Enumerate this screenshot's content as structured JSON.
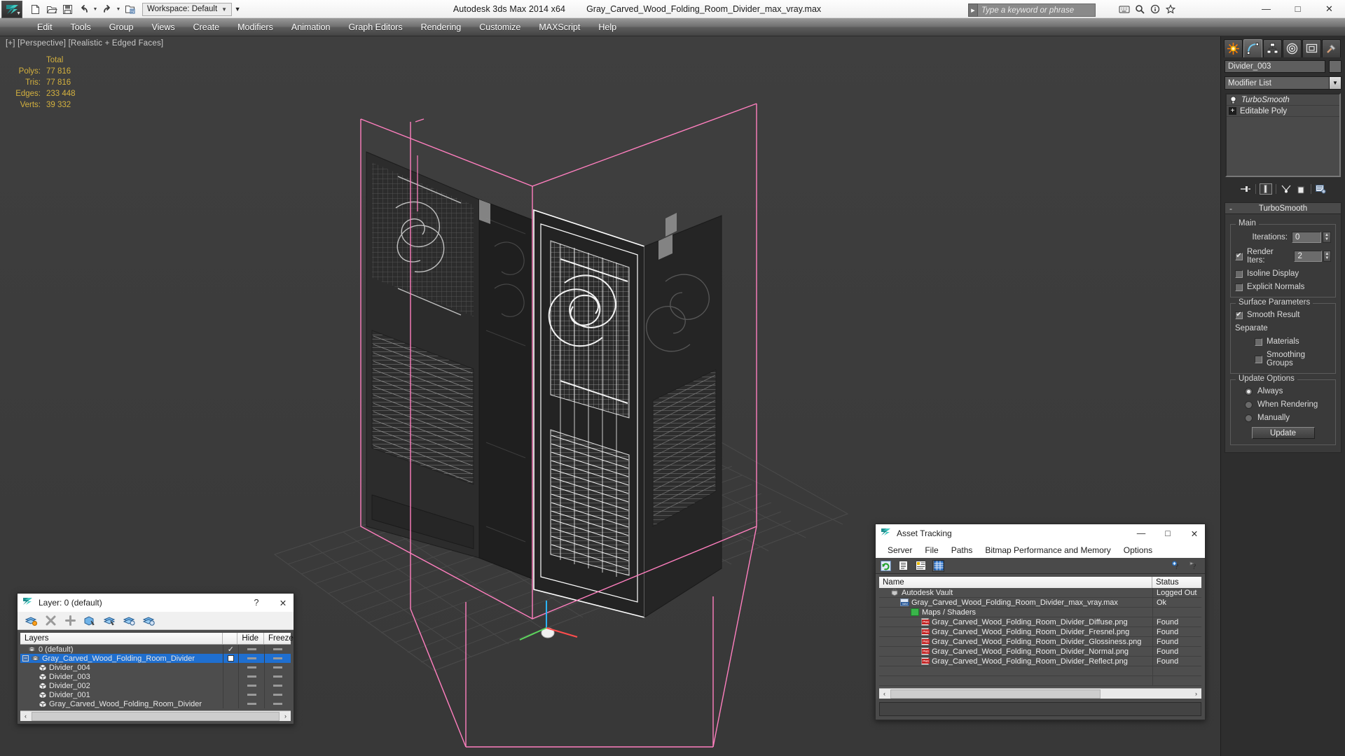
{
  "app": {
    "product_title": "Autodesk 3ds Max  2014 x64",
    "file_title": "Gray_Carved_Wood_Folding_Room_Divider_max_vray.max",
    "logo_icon": "3dsmax-logo-icon"
  },
  "window_controls": {
    "minimize": "—",
    "maximize": "□",
    "close": "✕"
  },
  "quick_access": {
    "items": [
      {
        "name": "new-file-icon",
        "glyph": "new"
      },
      {
        "name": "open-file-icon",
        "glyph": "open"
      },
      {
        "name": "save-file-icon",
        "glyph": "save"
      },
      {
        "name": "undo-icon",
        "glyph": "undo"
      },
      {
        "name": "redo-icon",
        "glyph": "redo"
      },
      {
        "name": "set-project-folder-icon",
        "glyph": "project"
      }
    ],
    "workspace_label": "Workspace: Default",
    "workspace_dropdown_icon": "chevron-down-icon"
  },
  "menu": {
    "items": [
      "Edit",
      "Tools",
      "Group",
      "Views",
      "Create",
      "Modifiers",
      "Animation",
      "Graph Editors",
      "Rendering",
      "Customize",
      "MAXScript",
      "Help"
    ]
  },
  "search": {
    "placeholder": "Type a keyword or phrase",
    "value": "",
    "arrow_icon": "triangle-right-icon",
    "trailing_icons": [
      "keyboard-shortcut-icon",
      "search-icon",
      "info-icon",
      "favorites-star-icon"
    ]
  },
  "viewport": {
    "label": "[+] [Perspective] [Realistic + Edged Faces]",
    "stats": {
      "header": "Total",
      "rows": [
        {
          "label": "Polys:",
          "value": "77 816"
        },
        {
          "label": "Tris:",
          "value": "77 816"
        },
        {
          "label": "Edges:",
          "value": "233 448"
        },
        {
          "label": "Verts:",
          "value": "39 332"
        }
      ]
    },
    "stats_color": "#d4b13e",
    "background_color": "#3c3c3c",
    "selection_bracket_color": "#ff7fbf"
  },
  "command_panel": {
    "tabs": [
      {
        "name": "create-tab",
        "icon": "star-burst-icon",
        "active": false
      },
      {
        "name": "modify-tab",
        "icon": "curve-arc-icon",
        "active": true
      },
      {
        "name": "hierarchy-tab",
        "icon": "hierarchy-icon",
        "active": false
      },
      {
        "name": "motion-tab",
        "icon": "motion-wheel-icon",
        "active": false
      },
      {
        "name": "display-tab",
        "icon": "display-monitor-icon",
        "active": false
      },
      {
        "name": "utilities-tab",
        "icon": "hammer-icon",
        "active": false
      }
    ],
    "object_name": "Divider_003",
    "modifier_list_label": "Modifier List",
    "modifier_stack": [
      {
        "label": "TurboSmooth",
        "icon": "lightbulb-icon",
        "italic": true
      },
      {
        "label": "Editable Poly",
        "icon": "plus-box-icon",
        "italic": false
      }
    ],
    "stack_buttons": [
      {
        "name": "pin-stack-button",
        "icon": "pin-icon"
      },
      {
        "name": "show-end-result-button",
        "icon": "show-end-result-icon"
      },
      {
        "name": "make-unique-button",
        "icon": "make-unique-icon"
      },
      {
        "name": "remove-modifier-button",
        "icon": "trash-icon"
      },
      {
        "name": "configure-modifier-sets-button",
        "icon": "configure-sets-icon"
      }
    ],
    "rollout": {
      "title": "TurboSmooth",
      "collapse_glyph": "-",
      "main_group": {
        "title": "Main",
        "iterations_label": "Iterations:",
        "iterations_value": "0",
        "render_iters_label": "Render Iters:",
        "render_iters_value": "2",
        "render_iters_checked": true,
        "isoline_display_label": "Isoline Display",
        "isoline_display_checked": false,
        "explicit_normals_label": "Explicit Normals",
        "explicit_normals_checked": false
      },
      "surface_group": {
        "title": "Surface Parameters",
        "smooth_result_label": "Smooth Result",
        "smooth_result_checked": true,
        "separate_label": "Separate",
        "materials_label": "Materials",
        "materials_checked": false,
        "smoothing_groups_label": "Smoothing Groups",
        "smoothing_groups_checked": false
      },
      "update_group": {
        "title": "Update Options",
        "options": [
          {
            "label": "Always",
            "selected": true
          },
          {
            "label": "When Rendering",
            "selected": false
          },
          {
            "label": "Manually",
            "selected": false
          }
        ],
        "update_button": "Update"
      }
    }
  },
  "layer_dialog": {
    "title": "Layer: 0 (default)",
    "help_glyph": "?",
    "close_glyph": "✕",
    "toolbar_icons": [
      {
        "name": "create-new-layer-icon"
      },
      {
        "name": "delete-highlighted-layer-icon"
      },
      {
        "name": "add-selection-to-layer-icon"
      },
      {
        "name": "select-objects-in-layer-icon"
      },
      {
        "name": "highlight-selected-objects-layer-icon"
      },
      {
        "name": "set-current-layer-to-selection-icon"
      },
      {
        "name": "layer-properties-icon"
      }
    ],
    "columns": [
      "Layers",
      "",
      "Hide",
      "Freeze"
    ],
    "rows": [
      {
        "name": "0 (default)",
        "indent": 0,
        "icon": "layers-icon",
        "current": true,
        "selected": false,
        "hide": "-",
        "freeze": "-"
      },
      {
        "name": "Gray_Carved_Wood_Folding_Room_Divider",
        "indent": 1,
        "icon": "layers-icon",
        "expander": "-",
        "current": false,
        "selected": true,
        "hide": "-",
        "freeze": "-"
      },
      {
        "name": "Divider_004",
        "indent": 2,
        "icon": "cube-icon",
        "current": false,
        "selected": false,
        "hide": "-",
        "freeze": "-"
      },
      {
        "name": "Divider_003",
        "indent": 2,
        "icon": "cube-icon",
        "current": false,
        "selected": false,
        "hide": "-",
        "freeze": "-"
      },
      {
        "name": "Divider_002",
        "indent": 2,
        "icon": "cube-icon",
        "current": false,
        "selected": false,
        "hide": "-",
        "freeze": "-"
      },
      {
        "name": "Divider_001",
        "indent": 2,
        "icon": "cube-icon",
        "current": false,
        "selected": false,
        "hide": "-",
        "freeze": "-"
      },
      {
        "name": "Gray_Carved_Wood_Folding_Room_Divider",
        "indent": 2,
        "icon": "cube-icon",
        "current": false,
        "selected": false,
        "hide": "-",
        "freeze": "-"
      }
    ],
    "scroll_left_glyph": "‹",
    "scroll_right_glyph": "›"
  },
  "asset_tracking": {
    "title": "Asset Tracking",
    "title_icon": "3dsmax-logo-icon",
    "minimize_glyph": "—",
    "maximize_glyph": "□",
    "close_glyph": "✕",
    "menu": [
      "Server",
      "File",
      "Paths",
      "Bitmap Performance and Memory",
      "Options"
    ],
    "toolbar_icons": [
      {
        "name": "refresh-icon",
        "selected": false
      },
      {
        "name": "list-view-icon",
        "selected": false
      },
      {
        "name": "details-view-icon",
        "selected": false
      },
      {
        "name": "grid-view-icon",
        "selected": true
      }
    ],
    "help_icons": [
      {
        "name": "help-add-icon"
      },
      {
        "name": "help-question-icon"
      }
    ],
    "columns": [
      "Name",
      "Status"
    ],
    "rows": [
      {
        "name": "Autodesk Vault",
        "status": "Logged Out",
        "indent": 0,
        "icon": "vault-icon"
      },
      {
        "name": "Gray_Carved_Wood_Folding_Room_Divider_max_vray.max",
        "status": "Ok",
        "indent": 1,
        "icon": "max-file-icon"
      },
      {
        "name": "Maps / Shaders",
        "status": "",
        "indent": 2,
        "icon": "maps-shaders-icon"
      },
      {
        "name": "Gray_Carved_Wood_Folding_Room_Divider_Diffuse.png",
        "status": "Found",
        "indent": 3,
        "icon": "png-file-icon"
      },
      {
        "name": "Gray_Carved_Wood_Folding_Room_Divider_Fresnel.png",
        "status": "Found",
        "indent": 3,
        "icon": "png-file-icon"
      },
      {
        "name": "Gray_Carved_Wood_Folding_Room_Divider_Glossiness.png",
        "status": "Found",
        "indent": 3,
        "icon": "png-file-icon"
      },
      {
        "name": "Gray_Carved_Wood_Folding_Room_Divider_Normal.png",
        "status": "Found",
        "indent": 3,
        "icon": "png-file-icon"
      },
      {
        "name": "Gray_Carved_Wood_Folding_Room_Divider_Reflect.png",
        "status": "Found",
        "indent": 3,
        "icon": "png-file-icon"
      },
      {
        "name": "",
        "status": "",
        "indent": 0,
        "icon": ""
      },
      {
        "name": "",
        "status": "",
        "indent": 0,
        "icon": ""
      }
    ],
    "scroll_left_glyph": "‹",
    "scroll_right_glyph": "›",
    "status_bar_text": ""
  }
}
